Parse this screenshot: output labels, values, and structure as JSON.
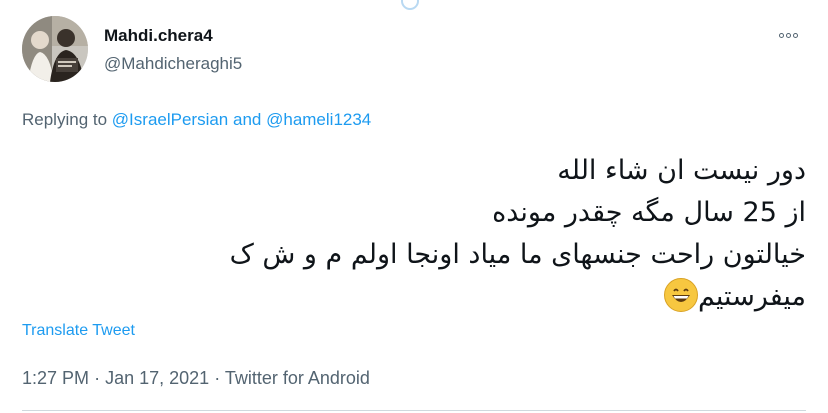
{
  "tweet": {
    "author": {
      "display_name": "Mahdi.chera4",
      "username": "@Mahdicheraghi5"
    },
    "replying": {
      "prefix": "Replying to",
      "user1": "@IsraelPersian",
      "conj": "and",
      "user2": "@hameli1234"
    },
    "text_lines": [
      "دور نیست ان شاء الله",
      "از 25 سال مگه چقدر مونده",
      "خیالتون راحت جنسهای ما میاد اونجا اولم م و ش ک",
      "میفرستیم"
    ],
    "emoji": "grinning-face-with-smiling-eyes",
    "translate_label": "Translate Tweet",
    "time": "1:27 PM",
    "separator": "·",
    "date": "Jan 17, 2021",
    "source": "Twitter for Android"
  },
  "colors": {
    "link": "#1d9bf0",
    "secondary_text": "#536471",
    "primary_text": "#0f1419",
    "divider": "#cfd9de"
  }
}
